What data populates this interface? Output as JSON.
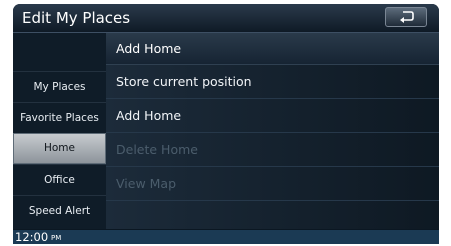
{
  "window": {
    "title": "Edit My Places",
    "back_icon": "return-arrow-icon"
  },
  "sidebar": {
    "items": [
      {
        "label": "My Places",
        "active": false
      },
      {
        "label": "Favorite Places",
        "active": false
      },
      {
        "label": "Home",
        "active": true
      },
      {
        "label": "Office",
        "active": false
      },
      {
        "label": "Speed Alert",
        "active": false
      }
    ]
  },
  "main": {
    "header": "Add Home",
    "rows": [
      {
        "label": "Store current position",
        "enabled": true
      },
      {
        "label": "Add Home",
        "enabled": true
      },
      {
        "label": "Delete Home",
        "enabled": false
      },
      {
        "label": "View Map",
        "enabled": false
      }
    ]
  },
  "status": {
    "time": "12:00",
    "ampm": "PM"
  },
  "colors": {
    "background": "#0b1722",
    "active_tab": "#c7cbcf",
    "disabled_text": "#4b5d6c",
    "status_bar": "#1b3a54"
  }
}
